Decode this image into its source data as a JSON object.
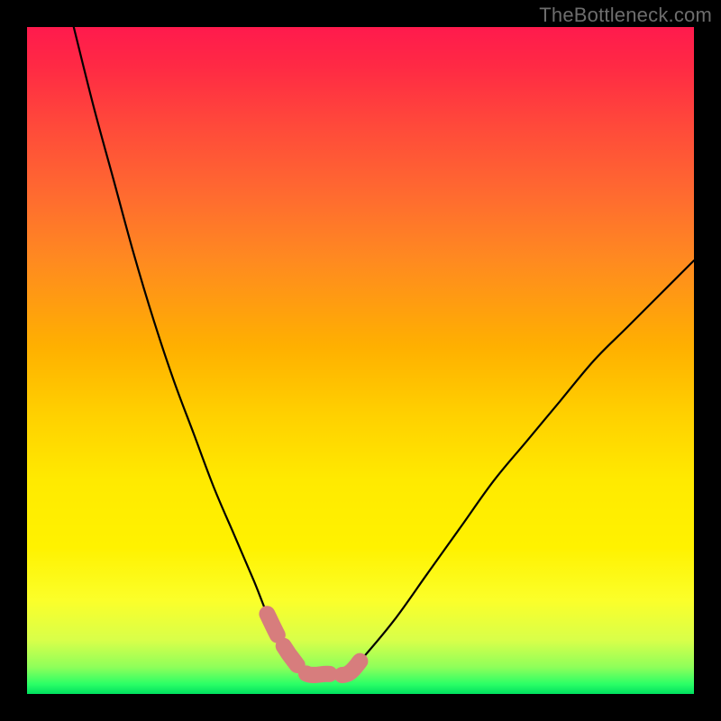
{
  "watermark": "TheBottleneck.com",
  "chart_data": {
    "type": "line",
    "title": "",
    "xlabel": "",
    "ylabel": "",
    "xlim": [
      0,
      100
    ],
    "ylim": [
      0,
      100
    ],
    "series": [
      {
        "name": "bottleneck-curve",
        "x": [
          7,
          10,
          13,
          16,
          19,
          22,
          25,
          28,
          31,
          34,
          36,
          38,
          40,
          42,
          45,
          48,
          50,
          55,
          60,
          65,
          70,
          75,
          80,
          85,
          90,
          95,
          100
        ],
        "y": [
          100,
          88,
          77,
          66,
          56,
          47,
          39,
          31,
          24,
          17,
          12,
          8,
          5,
          3,
          3,
          3,
          5,
          11,
          18,
          25,
          32,
          38,
          44,
          50,
          55,
          60,
          65
        ]
      }
    ],
    "highlight": {
      "name": "sweet-spot",
      "color": "#d77d7d",
      "x": [
        36,
        38,
        40,
        42,
        45,
        48,
        50
      ],
      "y": [
        12,
        8,
        5,
        3,
        3,
        3,
        5
      ]
    },
    "background_gradient": {
      "top": "#ff1a4d",
      "mid": "#ffea00",
      "bottom": "#00e060"
    }
  }
}
